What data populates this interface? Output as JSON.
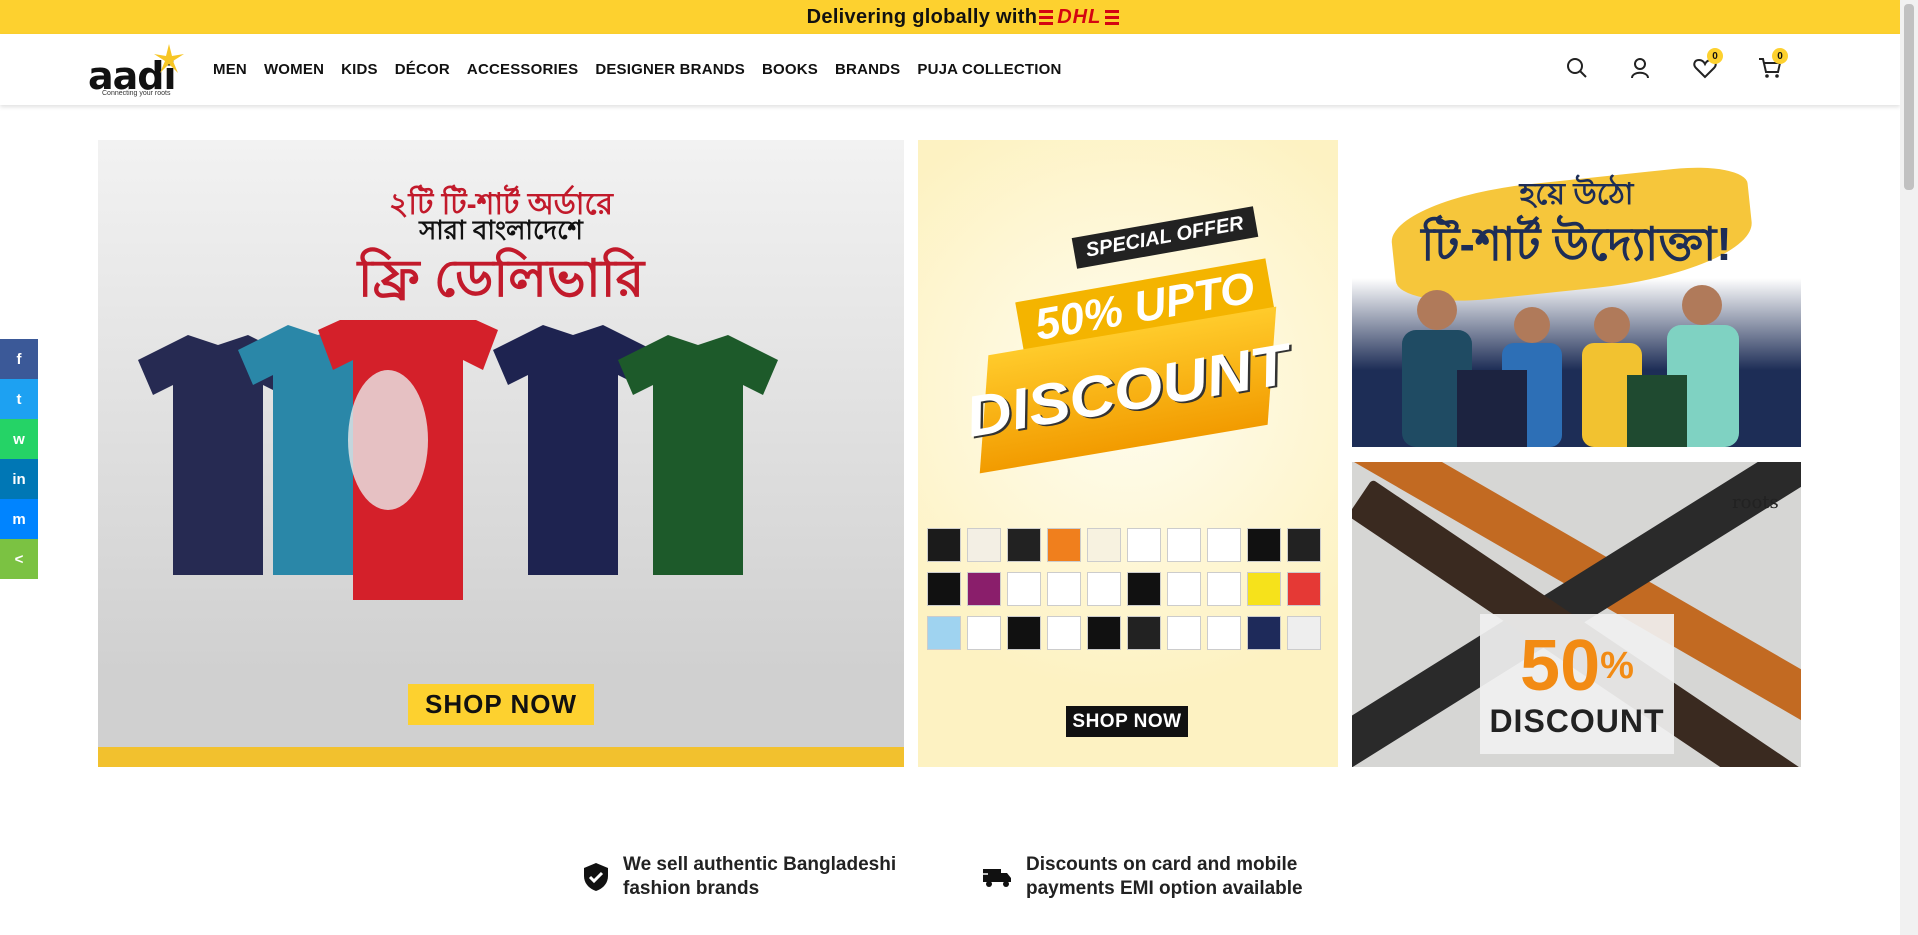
{
  "topbar": {
    "text": "Delivering globally with",
    "carrier": "DHL"
  },
  "brand": {
    "logo": "aadi",
    "tagline": "Connecting your roots"
  },
  "nav": [
    "MEN",
    "WOMEN",
    "KIDS",
    "DÉCOR",
    "ACCESSORIES",
    "DESIGNER BRANDS",
    "BOOKS",
    "BRANDS",
    "PUJA COLLECTION"
  ],
  "header_icons": {
    "wishlist_count": "0",
    "cart_count": "0"
  },
  "share": [
    "f",
    "t",
    "w",
    "in",
    "m",
    "<"
  ],
  "banner1": {
    "line1": "২টি টি-শার্ট অর্ডারে",
    "line2": "সারা বাংলাদেশে",
    "line3": "ফ্রি ডেলিভারি",
    "cta": "SHOP NOW"
  },
  "banner2": {
    "badge": "SPECIAL OFFER",
    "line1": "50% UPTO",
    "line2": "DISCOUNT",
    "cta": "SHOP NOW"
  },
  "banner3": {
    "line1": "হয়ে উঠো",
    "line2": "টি-শার্ট উদ্যোক্তা!"
  },
  "banner4": {
    "brand": "roots",
    "pct": "50",
    "pct_sign": "%",
    "label": "DISCOUNT"
  },
  "features": [
    {
      "line1": "We sell authentic Bangladeshi",
      "line2": "fashion brands"
    },
    {
      "line1": "Discounts on card and mobile",
      "line2": "payments EMI option available"
    }
  ],
  "colors": {
    "accent": "#fdd12f",
    "red": "#c21a2b",
    "dhl": "#d40511"
  }
}
